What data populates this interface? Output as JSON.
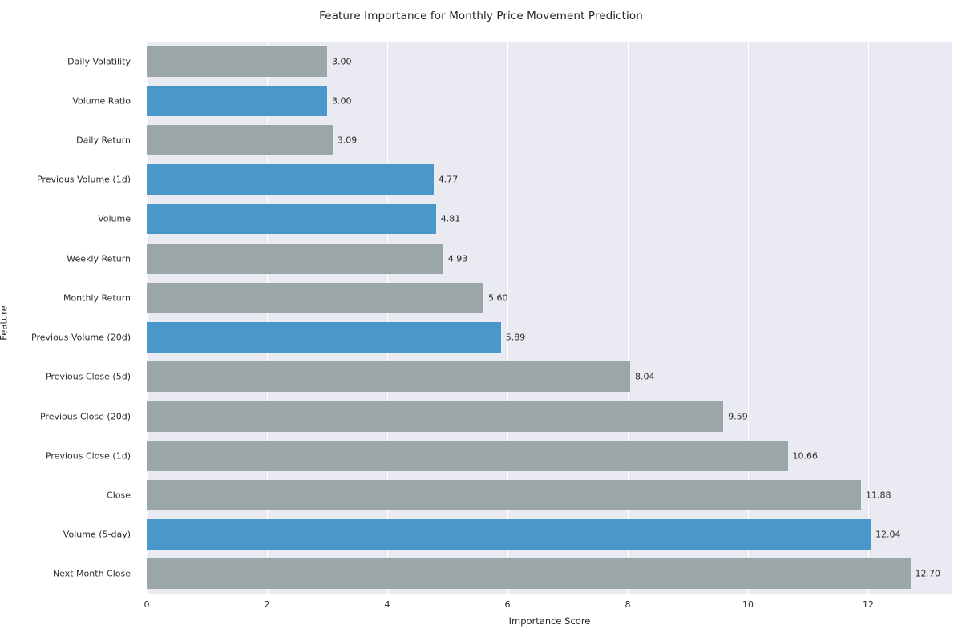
{
  "chart_data": {
    "type": "bar",
    "orientation": "horizontal",
    "title": "Feature Importance for Monthly Price Movement Prediction",
    "xlabel": "Importance Score",
    "ylabel": "Feature",
    "xlim": [
      0,
      13.4
    ],
    "ylim_categories": 14,
    "grid": true,
    "legend": null,
    "xticks": [
      "0",
      "2",
      "4",
      "6",
      "8",
      "10",
      "12"
    ],
    "xtick_values": [
      0,
      2,
      4,
      6,
      8,
      10,
      12
    ],
    "categories": [
      "Daily Volatility",
      "Volume Ratio",
      "Daily Return",
      "Previous Volume (1d)",
      "Volume",
      "Weekly Return",
      "Monthly Return",
      "Previous Volume (20d)",
      "Previous Close (5d)",
      "Previous Close (20d)",
      "Previous Close (1d)",
      "Close",
      "Volume (5-day)",
      "Next Month Close"
    ],
    "values": [
      3.0,
      3.0,
      3.09,
      4.77,
      4.81,
      4.93,
      5.6,
      5.89,
      8.04,
      9.59,
      10.66,
      11.88,
      12.04,
      12.7
    ],
    "value_labels": [
      "3.00",
      "3.00",
      "3.09",
      "4.77",
      "4.81",
      "4.93",
      "5.60",
      "5.89",
      "8.04",
      "9.59",
      "10.66",
      "11.88",
      "12.04",
      "12.70"
    ],
    "bar_colors": [
      "gray",
      "blue",
      "gray",
      "blue",
      "blue",
      "gray",
      "gray",
      "blue",
      "gray",
      "gray",
      "gray",
      "gray",
      "blue",
      "gray"
    ],
    "colors": {
      "gray": "#9aa6a8",
      "blue": "#4a98c9",
      "plot_background": "#eaeaf2",
      "gridline": "#ffffff",
      "figure_background": "#ffffff",
      "text": "#2b2b2b"
    }
  }
}
